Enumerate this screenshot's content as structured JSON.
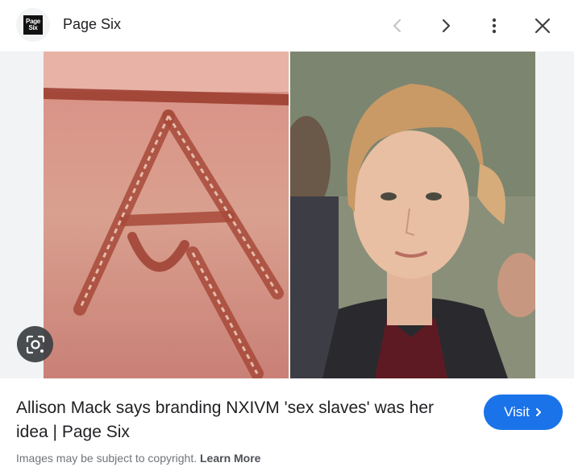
{
  "header": {
    "logo_line1": "Page",
    "logo_line2": "Six",
    "source_name": "Page Six",
    "icons": [
      "chevron-left-icon",
      "chevron-right-icon",
      "more-vert-icon",
      "close-icon"
    ]
  },
  "image": {
    "lens_icon": "lens-search-icon"
  },
  "result": {
    "title": "Allison Mack says branding NXIVM 'sex slaves' was her idea | Page Six",
    "visit_label": "Visit",
    "visit_icon": "chevron-right-icon"
  },
  "footer": {
    "copyright_text": "Images may be subject to copyright.",
    "learn_more": "Learn More"
  },
  "colors": {
    "accent": "#1a73e8",
    "text": "#202124",
    "muted": "#70757a"
  }
}
